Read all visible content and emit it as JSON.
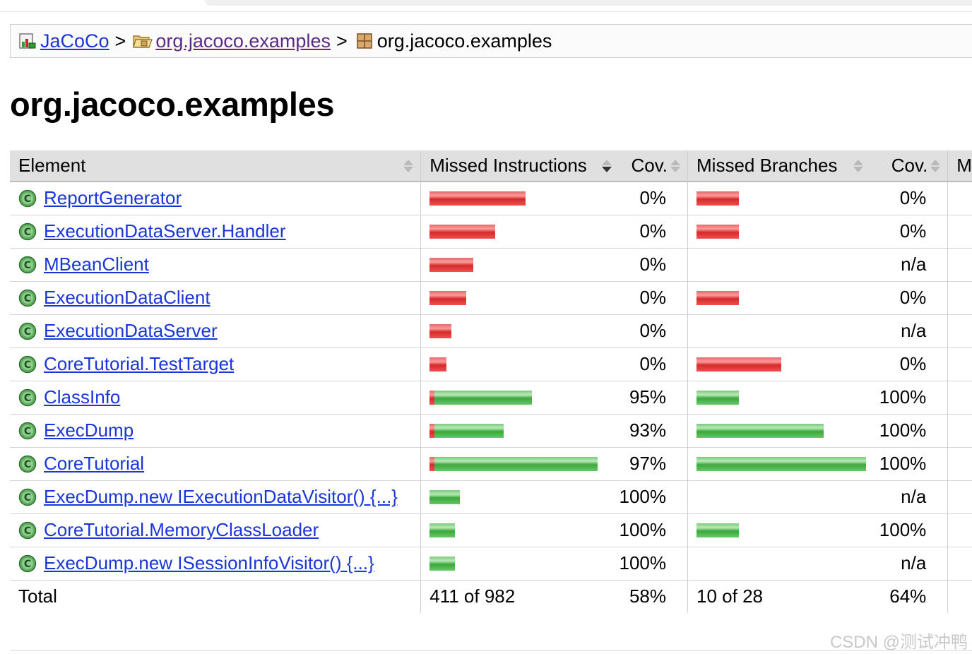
{
  "breadcrumb": {
    "root": "JaCoCo",
    "bundle": "org.jacoco.examples",
    "current": "org.jacoco.examples",
    "separator": ">"
  },
  "page_title": "org.jacoco.examples",
  "table": {
    "headers": {
      "element": "Element",
      "missed_instructions": "Missed Instructions",
      "cov1": "Cov.",
      "missed_branches": "Missed Branches",
      "cov2": "Cov.",
      "next": "M"
    },
    "rows": [
      {
        "name": "ReportGenerator",
        "instr_missed_frac": 1.0,
        "instr_bar_rel": 0.57,
        "instr_cov": "0%",
        "branch_missed_frac": 1.0,
        "branch_bar_rel": 0.25,
        "branch_cov": "0%"
      },
      {
        "name": "ExecutionDataServer.Handler",
        "instr_missed_frac": 1.0,
        "instr_bar_rel": 0.39,
        "instr_cov": "0%",
        "branch_missed_frac": 1.0,
        "branch_bar_rel": 0.25,
        "branch_cov": "0%"
      },
      {
        "name": "MBeanClient",
        "instr_missed_frac": 1.0,
        "instr_bar_rel": 0.26,
        "instr_cov": "0%",
        "branch_missed_frac": null,
        "branch_bar_rel": 0,
        "branch_cov": "n/a"
      },
      {
        "name": "ExecutionDataClient",
        "instr_missed_frac": 1.0,
        "instr_bar_rel": 0.22,
        "instr_cov": "0%",
        "branch_missed_frac": 1.0,
        "branch_bar_rel": 0.25,
        "branch_cov": "0%"
      },
      {
        "name": "ExecutionDataServer",
        "instr_missed_frac": 1.0,
        "instr_bar_rel": 0.13,
        "instr_cov": "0%",
        "branch_missed_frac": null,
        "branch_bar_rel": 0,
        "branch_cov": "n/a"
      },
      {
        "name": "CoreTutorial.TestTarget",
        "instr_missed_frac": 1.0,
        "instr_bar_rel": 0.1,
        "instr_cov": "0%",
        "branch_missed_frac": 1.0,
        "branch_bar_rel": 0.5,
        "branch_cov": "0%"
      },
      {
        "name": "ClassInfo",
        "instr_missed_frac": 0.05,
        "instr_bar_rel": 0.61,
        "instr_cov": "95%",
        "branch_missed_frac": 0.0,
        "branch_bar_rel": 0.25,
        "branch_cov": "100%"
      },
      {
        "name": "ExecDump",
        "instr_missed_frac": 0.07,
        "instr_bar_rel": 0.44,
        "instr_cov": "93%",
        "branch_missed_frac": 0.0,
        "branch_bar_rel": 0.75,
        "branch_cov": "100%"
      },
      {
        "name": "CoreTutorial",
        "instr_missed_frac": 0.03,
        "instr_bar_rel": 1.0,
        "instr_cov": "97%",
        "branch_missed_frac": 0.0,
        "branch_bar_rel": 1.0,
        "branch_cov": "100%"
      },
      {
        "name": "ExecDump.new IExecutionDataVisitor() {...}",
        "instr_missed_frac": 0.0,
        "instr_bar_rel": 0.18,
        "instr_cov": "100%",
        "branch_missed_frac": null,
        "branch_bar_rel": 0,
        "branch_cov": "n/a"
      },
      {
        "name": "CoreTutorial.MemoryClassLoader",
        "instr_missed_frac": 0.0,
        "instr_bar_rel": 0.15,
        "instr_cov": "100%",
        "branch_missed_frac": 0.0,
        "branch_bar_rel": 0.25,
        "branch_cov": "100%"
      },
      {
        "name": "ExecDump.new ISessionInfoVisitor() {...}",
        "instr_missed_frac": 0.0,
        "instr_bar_rel": 0.15,
        "instr_cov": "100%",
        "branch_missed_frac": null,
        "branch_bar_rel": 0,
        "branch_cov": "n/a"
      }
    ],
    "total": {
      "label": "Total",
      "instructions": "411 of 982",
      "instr_cov": "58%",
      "branches": "10 of 28",
      "branch_cov": "64%"
    }
  },
  "watermark": "CSDN @测试冲鸭",
  "colors": {
    "link": "#1a35d8",
    "visited": "#5b2a86",
    "missed": "#e04040",
    "covered": "#4cb84c",
    "header_bg": "#e0e0e0"
  },
  "icons": {
    "report": "report-icon",
    "bundle": "bundle-folder-icon",
    "package": "package-icon",
    "class": "class-icon"
  }
}
